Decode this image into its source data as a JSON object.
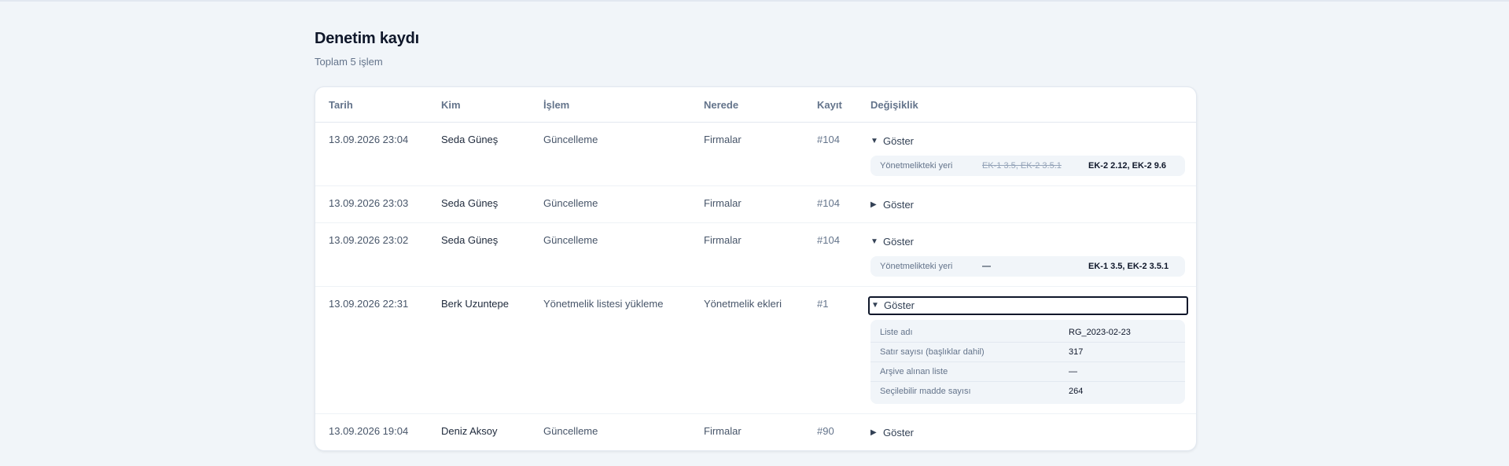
{
  "page": {
    "title": "Denetim kaydı",
    "subtitle": "Toplam 5 işlem"
  },
  "table": {
    "headers": [
      "Tarih",
      "Kim",
      "İşlem",
      "Nerede",
      "Kayıt",
      "Değişiklik"
    ],
    "toggle_label": "Göster",
    "rows": [
      {
        "date": "13.09.2026 23:04",
        "who": "Seda Güneş",
        "action": "Güncelleme",
        "where": "Firmalar",
        "record": "#104",
        "expanded": true,
        "diff": {
          "label": "Yönetmelikteki yeri",
          "old": "EK-1 3.5, EK-2 3.5.1",
          "new": "EK-2 2.12, EK-2 9.6"
        }
      },
      {
        "date": "13.09.2026 23:03",
        "who": "Seda Güneş",
        "action": "Güncelleme",
        "where": "Firmalar",
        "record": "#104",
        "expanded": false
      },
      {
        "date": "13.09.2026 23:02",
        "who": "Seda Güneş",
        "action": "Güncelleme",
        "where": "Firmalar",
        "record": "#104",
        "expanded": true,
        "diff": {
          "label": "Yönetmelikteki yeri",
          "old": "—",
          "new": "EK-1 3.5, EK-2 3.5.1"
        }
      },
      {
        "date": "13.09.2026 22:31",
        "who": "Berk Uzuntepe",
        "action": "Yönetmelik listesi yükleme",
        "where": "Yönetmelik ekleri",
        "record": "#1",
        "expanded": true,
        "details": [
          {
            "key": "Liste adı",
            "value": "RG_2023-02-23"
          },
          {
            "key": "Satır sayısı (başlıklar dahil)",
            "value": "317"
          },
          {
            "key": "Arşive alınan liste",
            "value": "—"
          },
          {
            "key": "Seçilebilir madde sayısı",
            "value": "264"
          }
        ]
      },
      {
        "date": "13.09.2026 19:04",
        "who": "Deniz Aksoy",
        "action": "Güncelleme",
        "where": "Firmalar",
        "record": "#90",
        "expanded": false
      }
    ]
  },
  "icons": {
    "expanded": "triangle-down-icon",
    "collapsed": "triangle-right-icon"
  },
  "colors": {
    "background": "#f1f5f9",
    "card": "#ffffff",
    "muted": "#64748b",
    "text": "#0f172a"
  }
}
